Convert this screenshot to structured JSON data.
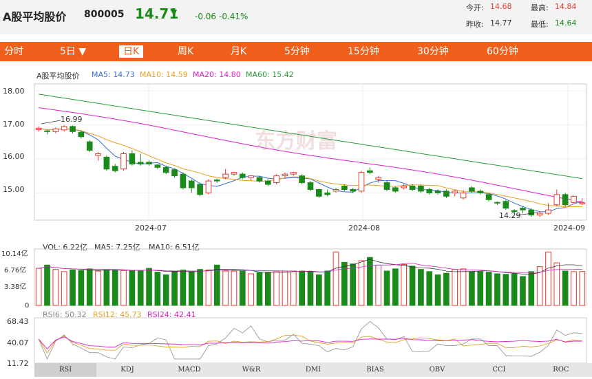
{
  "header": {
    "name": "A股平均股价",
    "code": "800005",
    "price": "14.71",
    "arrow": "▼",
    "change": "-0.06",
    "change_pct": "-0.41%",
    "quote": [
      {
        "label": "今开:",
        "value": "14.68"
      },
      {
        "label": "最高:",
        "value": "14.84"
      },
      {
        "label": "昨收:",
        "value": "14.77"
      },
      {
        "label": "最低:",
        "value": "14.64"
      }
    ]
  },
  "tabs": [
    "分时",
    "5日 ▼",
    "日K",
    "周K",
    "月K",
    "5分钟",
    "15分钟",
    "30分钟",
    "60分钟"
  ],
  "active_tab": "日K",
  "watermark": "东方财富",
  "kline": {
    "legend_title": "A股平均股价",
    "ma": [
      {
        "label": "MA5: 14.73",
        "color": "#3a6fd8"
      },
      {
        "label": "MA10: 14.59",
        "color": "#e8a020"
      },
      {
        "label": "MA20: 14.80",
        "color": "#e020c8"
      },
      {
        "label": "MA60: 15.42",
        "color": "#2a9a3a"
      }
    ],
    "y_ticks": [
      "18.00",
      "17.00",
      "16.00",
      "15.00"
    ],
    "x_ticks": [
      "2024-07",
      "2024-08",
      "2024-09"
    ],
    "annotations": [
      {
        "text": "16.99"
      },
      {
        "text": "14.29"
      }
    ]
  },
  "volume": {
    "legend": [
      {
        "label": "VOL: 6.22亿",
        "color": "#e020c8"
      },
      {
        "label": "MA5: 7.25亿",
        "color": "#333"
      },
      {
        "label": "MA10: 6.51亿",
        "color": "#e020c8"
      }
    ],
    "y_ticks": [
      "10.14亿",
      "6.76亿",
      "3.38亿",
      "0"
    ]
  },
  "rsi": {
    "legend": [
      {
        "label": "RSI6: 50.32",
        "color": "#888"
      },
      {
        "label": "RSI12: 45.73",
        "color": "#e8a020"
      },
      {
        "label": "RSI24: 42.41",
        "color": "#e020c8"
      }
    ],
    "y_ticks": [
      "68.43",
      "40.07",
      "11.72"
    ]
  },
  "indicator_tabs": [
    "RSI",
    "KDJ",
    "MACD",
    "W&R",
    "DMI",
    "BIAS",
    "OBV",
    "CCI",
    "ROC"
  ],
  "active_indicator": "RSI",
  "colors": {
    "up": "#e6392c",
    "down": "#1a8a1a",
    "accent": "#f0601c"
  },
  "chart_data": {
    "type": "candlestick",
    "title": "A股平均股价",
    "y_range": [
      14.2,
      18.2
    ],
    "candles": [
      [
        16.86,
        16.9,
        16.8,
        16.95
      ],
      [
        16.82,
        16.8,
        16.72,
        16.85
      ],
      [
        16.8,
        16.88,
        16.75,
        16.92
      ],
      [
        16.85,
        16.95,
        16.8,
        16.99
      ],
      [
        16.95,
        16.8,
        16.75,
        16.98
      ],
      [
        16.78,
        16.65,
        16.6,
        16.82
      ],
      [
        16.5,
        16.25,
        16.2,
        16.55
      ],
      [
        16.1,
        16.15,
        15.95,
        16.2
      ],
      [
        16.05,
        15.7,
        15.65,
        16.1
      ],
      [
        15.78,
        15.65,
        15.6,
        15.85
      ],
      [
        15.7,
        16.15,
        15.65,
        16.2
      ],
      [
        16.15,
        15.85,
        15.8,
        16.25
      ],
      [
        15.9,
        15.85,
        15.8,
        16.15
      ],
      [
        15.9,
        15.85,
        15.8,
        15.95
      ],
      [
        15.82,
        15.75,
        15.7,
        15.85
      ],
      [
        15.75,
        15.6,
        15.55,
        15.8
      ],
      [
        15.68,
        15.5,
        15.45,
        15.72
      ],
      [
        15.55,
        15.15,
        15.1,
        15.6
      ],
      [
        15.35,
        15.15,
        15.0,
        15.4
      ],
      [
        15.25,
        14.95,
        14.9,
        15.3
      ],
      [
        15.0,
        15.35,
        14.95,
        15.4
      ],
      [
        15.38,
        15.35,
        15.3,
        15.42
      ],
      [
        15.45,
        15.55,
        15.4,
        15.7
      ],
      [
        15.55,
        15.6,
        15.5,
        15.62
      ],
      [
        15.55,
        15.45,
        15.4,
        15.6
      ],
      [
        15.45,
        15.5,
        15.35,
        15.52
      ],
      [
        15.45,
        15.35,
        15.3,
        15.5
      ],
      [
        15.35,
        15.25,
        15.2,
        15.4
      ],
      [
        15.3,
        15.5,
        15.25,
        15.55
      ],
      [
        15.5,
        15.55,
        15.45,
        15.6
      ],
      [
        15.55,
        15.6,
        15.5,
        15.62
      ],
      [
        15.5,
        15.3,
        15.25,
        15.55
      ],
      [
        15.3,
        15.1,
        15.05,
        15.35
      ],
      [
        15.1,
        14.9,
        14.85,
        15.12
      ],
      [
        15.0,
        14.95,
        14.9,
        15.1
      ],
      [
        15.05,
        15.1,
        15.0,
        15.15
      ],
      [
        15.2,
        15.1,
        15.05,
        15.25
      ],
      [
        15.1,
        15.05,
        15.0,
        15.15
      ],
      [
        15.05,
        15.6,
        15.0,
        15.65
      ],
      [
        15.65,
        15.6,
        15.55,
        15.75
      ],
      [
        15.4,
        15.45,
        15.3,
        15.5
      ],
      [
        15.3,
        15.1,
        15.05,
        15.35
      ],
      [
        15.15,
        15.05,
        15.0,
        15.2
      ],
      [
        15.15,
        15.2,
        15.1,
        15.25
      ],
      [
        15.2,
        15.1,
        15.05,
        15.25
      ],
      [
        15.2,
        15.05,
        15.0,
        15.25
      ],
      [
        15.1,
        15.0,
        14.95,
        15.15
      ],
      [
        15.05,
        15.0,
        14.95,
        15.1
      ],
      [
        15.05,
        14.9,
        14.85,
        15.1
      ],
      [
        15.0,
        15.05,
        14.9,
        15.1
      ],
      [
        14.85,
        15.0,
        14.8,
        15.08
      ],
      [
        15.15,
        15.05,
        15.0,
        15.2
      ],
      [
        15.05,
        15.0,
        14.95,
        15.1
      ],
      [
        14.95,
        14.8,
        14.75,
        15.0
      ],
      [
        14.72,
        14.7,
        14.65,
        14.75
      ],
      [
        14.75,
        14.55,
        14.5,
        14.8
      ],
      [
        14.48,
        14.45,
        14.4,
        14.52
      ],
      [
        14.55,
        14.5,
        14.4,
        14.6
      ],
      [
        14.5,
        14.35,
        14.3,
        14.55
      ],
      [
        14.35,
        14.4,
        14.29,
        14.45
      ],
      [
        14.4,
        14.5,
        14.35,
        14.7
      ],
      [
        14.65,
        14.95,
        14.6,
        15.1
      ],
      [
        14.95,
        14.65,
        14.6,
        15.0
      ],
      [
        14.72,
        14.9,
        14.7,
        14.92
      ],
      [
        14.68,
        14.71,
        14.64,
        14.84
      ]
    ],
    "ma5_last": 14.73,
    "ma10_last": 14.59,
    "ma20_last": 14.8,
    "ma60_last": 15.42,
    "volume_unit": "亿",
    "volume_max": 10.14,
    "volumes": [
      6.8,
      7.4,
      6.6,
      6.2,
      6.5,
      6.4,
      6.7,
      6.3,
      6.5,
      6.5,
      6.4,
      6.4,
      6.3,
      6.8,
      6.1,
      5.6,
      6.3,
      6.5,
      6.2,
      6.6,
      6.5,
      7.4,
      6.3,
      6.3,
      6.3,
      5.8,
      6.0,
      6.0,
      6.3,
      6.3,
      6.3,
      6.3,
      6.2,
      5.6,
      6.3,
      9.8,
      7.9,
      7.6,
      8.2,
      8.8,
      7.4,
      6.3,
      6.7,
      7.5,
      7.2,
      6.6,
      6.2,
      5.6,
      5.9,
      6.6,
      6.7,
      6.2,
      6.2,
      6.1,
      5.8,
      5.7,
      5.8,
      5.3,
      6.2,
      7.1,
      9.8,
      7.8,
      6.3,
      6.2,
      6.22
    ],
    "rsi_range": [
      11.72,
      68.43
    ]
  }
}
